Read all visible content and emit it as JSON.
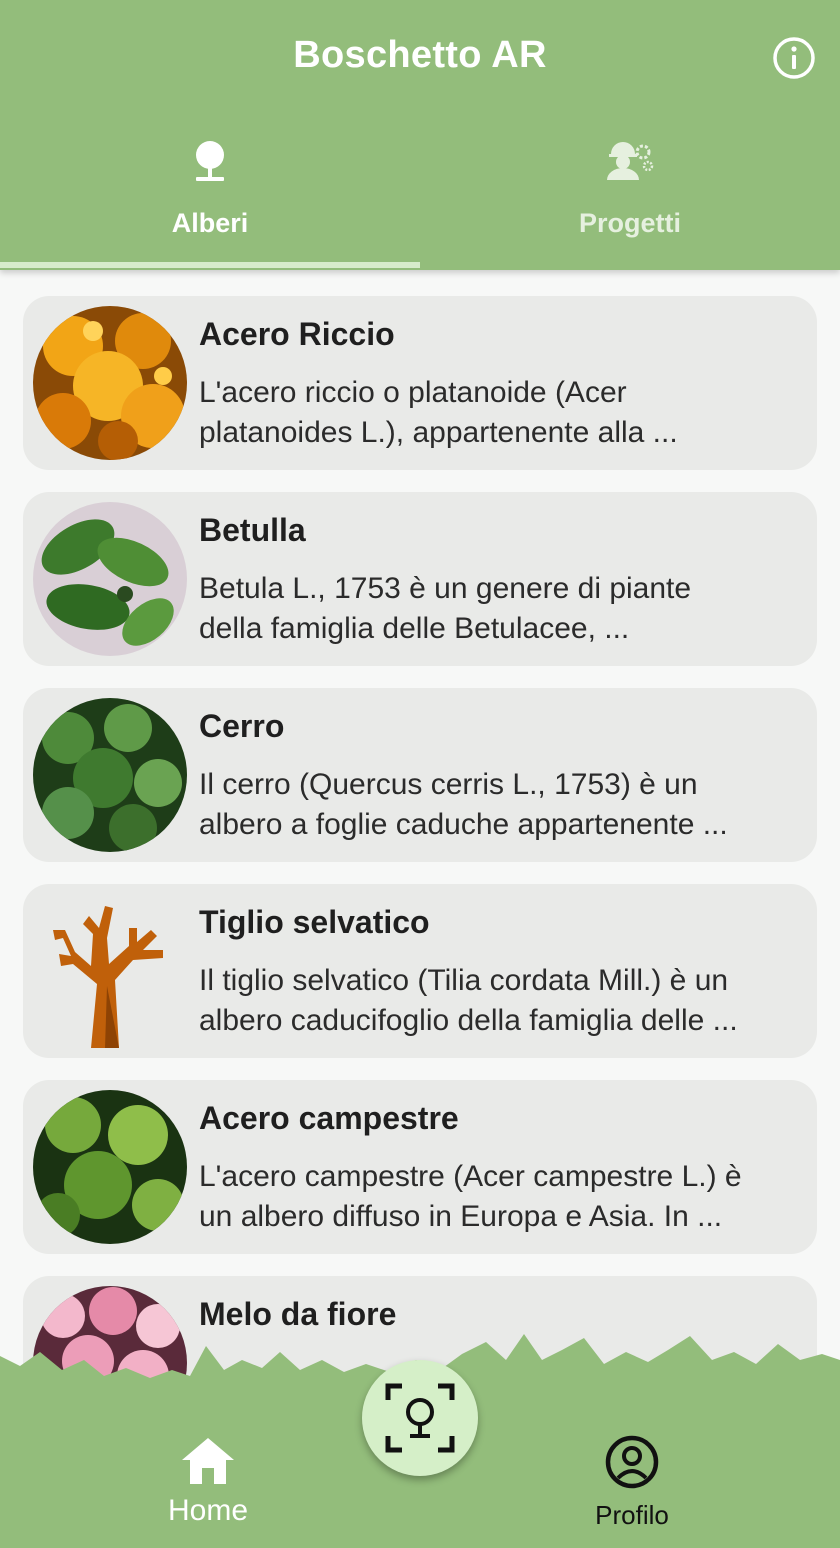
{
  "app": {
    "title": "Boschetto AR"
  },
  "tabs": [
    {
      "label": "Alberi",
      "icon": "tree-icon",
      "selected": true
    },
    {
      "label": "Progetti",
      "icon": "worker-gears-icon",
      "selected": false
    }
  ],
  "trees": [
    {
      "name": "Acero Riccio",
      "desc_line1": "L'acero riccio o platanoide (Acer",
      "desc_line2": "platanoides L.), appartenente alla ...",
      "image": "autumn-maple-leaves-photo"
    },
    {
      "name": "Betulla",
      "desc_line1": "Betula L., 1753 è un genere di piante",
      "desc_line2": "della famiglia delle Betulacee, ...",
      "image": "birch-leaves-photo"
    },
    {
      "name": "Cerro",
      "desc_line1": "Il cerro (Quercus cerris L., 1753) è un",
      "desc_line2": "albero a foglie caduche appartenente ...",
      "image": "oak-leaves-photo"
    },
    {
      "name": "Tiglio selvatico",
      "desc_line1": "Il tiglio selvatico (Tilia cordata Mill.) è un",
      "desc_line2": "albero caducifoglio della famiglia delle ...",
      "image": "bare-tree-icon"
    },
    {
      "name": "Acero campestre",
      "desc_line1": "L'acero campestre (Acer campestre L.) è",
      "desc_line2": "un albero diffuso in Europa e Asia. In ...",
      "image": "field-maple-leaves-photo"
    },
    {
      "name": "Melo da fiore",
      "desc_line1": "",
      "desc_line2": "",
      "image": "pink-blossom-photo"
    }
  ],
  "bottom_nav": {
    "home_label": "Home",
    "profile_label": "Profilo",
    "scan_icon": "ar-tree-scan-icon"
  },
  "colors": {
    "primary": "#93bd7b",
    "card": "#e9eae8",
    "fab": "#d5efc8",
    "tab_indicator": "#d7eccb"
  }
}
